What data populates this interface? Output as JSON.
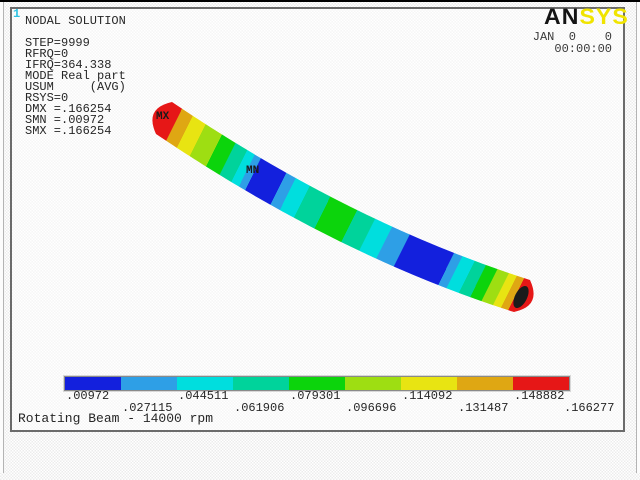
{
  "window": {
    "plot_number": "1",
    "logo_black": "AN",
    "logo_yellow": "SYS",
    "date": "JAN  0    0",
    "time": "00:00:00"
  },
  "solution_info": {
    "lines": [
      "NODAL SOLUTION",
      "",
      "STEP=9999",
      "RFRQ=0",
      "IFRQ=364.338",
      "MODE Real part",
      "USUM     (AVG)",
      "RSYS=0",
      "DMX =.166254",
      "SMN =.00972",
      "SMX =.166254"
    ]
  },
  "markers": {
    "max": "MX",
    "min": "MN"
  },
  "legend": {
    "values": [
      ".00972",
      ".027115",
      ".044511",
      ".061906",
      ".079301",
      ".096696",
      ".114092",
      ".131487",
      ".148882",
      ".166277"
    ],
    "colors": [
      "#1320dd",
      "#2e9fe6",
      "#00dede",
      "#00d39b",
      "#0cd40c",
      "#9ede12",
      "#e8e412",
      "#dfa713",
      "#e61717"
    ]
  },
  "caption": "Rotating Beam - 14000 rpm",
  "beam": {
    "bands": [
      {
        "hex": "#e61717",
        "from": 0.0,
        "to": 0.03
      },
      {
        "hex": "#dfa713",
        "from": 0.03,
        "to": 0.062
      },
      {
        "hex": "#e8e412",
        "from": 0.062,
        "to": 0.1
      },
      {
        "hex": "#9ede12",
        "from": 0.1,
        "to": 0.148
      },
      {
        "hex": "#0cd40c",
        "from": 0.148,
        "to": 0.188
      },
      {
        "hex": "#00d39b",
        "from": 0.188,
        "to": 0.222
      },
      {
        "hex": "#00dede",
        "from": 0.222,
        "to": 0.244
      },
      {
        "hex": "#2e9fe6",
        "from": 0.244,
        "to": 0.262
      },
      {
        "hex": "#1320dd",
        "from": 0.262,
        "to": 0.335
      },
      {
        "hex": "#2e9fe6",
        "from": 0.335,
        "to": 0.362
      },
      {
        "hex": "#00dede",
        "from": 0.362,
        "to": 0.402
      },
      {
        "hex": "#00d39b",
        "from": 0.402,
        "to": 0.46
      },
      {
        "hex": "#0cd40c",
        "from": 0.46,
        "to": 0.535
      },
      {
        "hex": "#00d39b",
        "from": 0.535,
        "to": 0.585
      },
      {
        "hex": "#00dede",
        "from": 0.585,
        "to": 0.632
      },
      {
        "hex": "#2e9fe6",
        "from": 0.632,
        "to": 0.68
      },
      {
        "hex": "#1320dd",
        "from": 0.68,
        "to": 0.8
      },
      {
        "hex": "#2e9fe6",
        "from": 0.8,
        "to": 0.822
      },
      {
        "hex": "#00dede",
        "from": 0.822,
        "to": 0.855
      },
      {
        "hex": "#00d39b",
        "from": 0.855,
        "to": 0.885
      },
      {
        "hex": "#0cd40c",
        "from": 0.885,
        "to": 0.915
      },
      {
        "hex": "#9ede12",
        "from": 0.915,
        "to": 0.945
      },
      {
        "hex": "#e8e412",
        "from": 0.945,
        "to": 0.966
      },
      {
        "hex": "#dfa713",
        "from": 0.966,
        "to": 0.985
      },
      {
        "hex": "#e61717",
        "from": 0.985,
        "to": 1.0
      }
    ]
  }
}
